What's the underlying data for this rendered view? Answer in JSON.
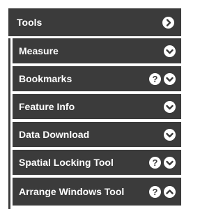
{
  "tools": {
    "label": "Tools",
    "icon": "chevron-right-circle-icon"
  },
  "items": [
    {
      "label": "Measure",
      "help": false,
      "state": "collapsed"
    },
    {
      "label": "Bookmarks",
      "help": true,
      "state": "collapsed"
    },
    {
      "label": "Feature Info",
      "help": false,
      "state": "collapsed"
    },
    {
      "label": "Data Download",
      "help": false,
      "state": "collapsed"
    },
    {
      "label": "Spatial Locking Tool",
      "help": true,
      "state": "collapsed"
    },
    {
      "label": "Arrange Windows Tool",
      "help": true,
      "state": "expanded"
    }
  ],
  "help_glyph": "?",
  "colors": {
    "bar": "#3b3b3b",
    "text": "#ffffff",
    "background": "#ffffff"
  }
}
